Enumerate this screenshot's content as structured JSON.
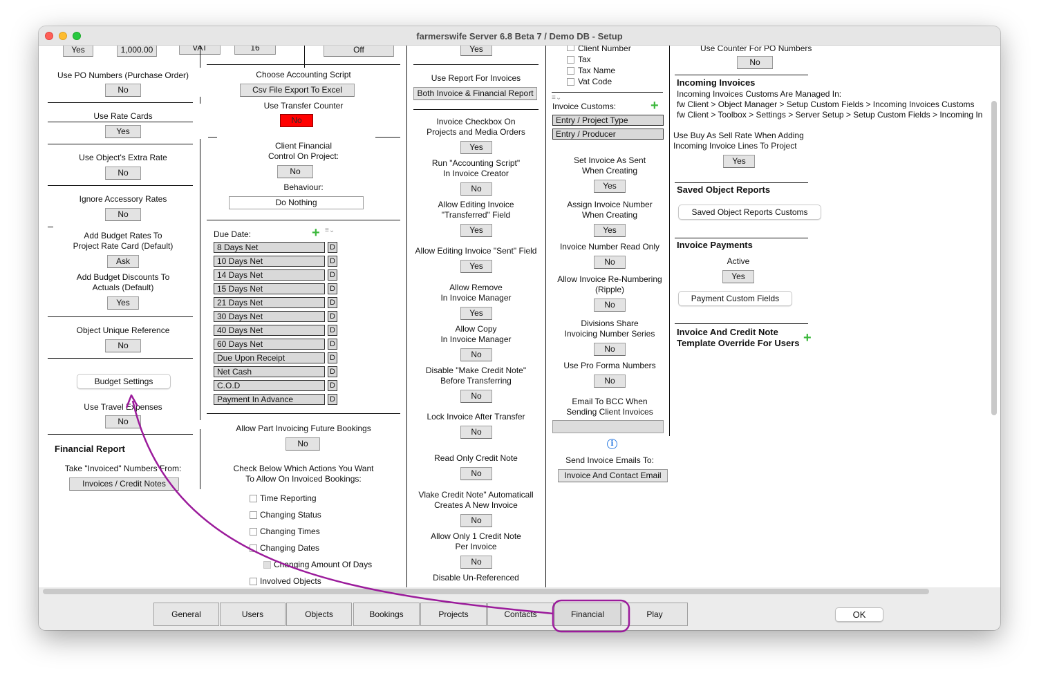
{
  "window": {
    "title": "farmerswife Server 6.8 Beta 7 / Demo DB - Setup"
  },
  "top_partial": {
    "yes1": "Yes",
    "amount": "1,000.00",
    "vat": "VAT",
    "vat_value": "16",
    "off": "Off",
    "yes2": "Yes",
    "client_number": "Client Number",
    "use_counter_po": "Use Counter For PO Numbers",
    "use_counter_po_value": "No"
  },
  "col1": {
    "use_po_numbers": "Use PO Numbers (Purchase Order)",
    "use_po_numbers_value": "No",
    "use_rate_cards": "Use Rate Cards",
    "use_rate_cards_value": "Yes",
    "use_objects_extra_rate": "Use Object's Extra Rate",
    "use_objects_extra_rate_value": "No",
    "ignore_accessory_rates": "Ignore Accessory Rates",
    "ignore_accessory_rates_value": "No",
    "add_budget_rates_1": "Add Budget Rates To",
    "add_budget_rates_2": "Project Rate Card (Default)",
    "add_budget_rates_value": "Ask",
    "add_budget_discounts_1": "Add Budget Discounts To",
    "add_budget_discounts_2": "Actuals (Default)",
    "add_budget_discounts_value": "Yes",
    "object_unique_reference": "Object Unique Reference",
    "object_unique_reference_value": "No",
    "budget_settings": "Budget Settings",
    "use_travel_expenses": "Use Travel Expenses",
    "use_travel_expenses_value": "No",
    "financial_report": "Financial Report",
    "take_invoiced_numbers": "Take \"Invoiced\" Numbers From:",
    "take_invoiced_numbers_value": "Invoices / Credit Notes"
  },
  "col2": {
    "choose_accounting_script": "Choose Accounting Script",
    "choose_accounting_script_value": "Csv File Export To Excel",
    "use_transfer_counter": "Use Transfer Counter",
    "use_transfer_counter_value": "No",
    "client_financial_1": "Client Financial",
    "client_financial_2": "Control On Project:",
    "client_financial_value": "No",
    "behaviour": "Behaviour:",
    "behaviour_value": "Do Nothing",
    "due_date": "Due Date:",
    "due_dates": [
      "8 Days Net",
      "10 Days Net",
      "14 Days Net",
      "15 Days Net",
      "21 Days Net",
      "30 Days Net",
      "40 Days Net",
      "60 Days Net",
      "Due Upon Receipt",
      "Net Cash",
      "C.O.D",
      "Payment In Advance"
    ],
    "d_marker": "D",
    "allow_part_invoicing": "Allow Part Invoicing Future Bookings",
    "allow_part_invoicing_value": "No",
    "check_below_1": "Check Below Which Actions You Want",
    "check_below_2": "To Allow On Invoiced Bookings:",
    "checks": [
      "Time Reporting",
      "Changing Status",
      "Changing Times",
      "Changing Dates",
      "Changing Amount Of Days",
      "Involved Objects"
    ]
  },
  "col3": {
    "use_report_for_invoices": "Use Report For Invoices",
    "use_report_for_invoices_value": "Both Invoice & Financial Report",
    "invoice_checkbox_1": "Invoice Checkbox On",
    "invoice_checkbox_2": "Projects and Media Orders",
    "invoice_checkbox_value": "Yes",
    "run_accounting_1": "Run \"Accounting Script\"",
    "run_accounting_2": "In Invoice Creator",
    "run_accounting_value": "No",
    "allow_editing_transferred_1": "Allow Editing Invoice",
    "allow_editing_transferred_2": "\"Transferred\" Field",
    "allow_editing_transferred_value": "Yes",
    "allow_editing_sent": "Allow Editing Invoice \"Sent\" Field",
    "allow_editing_sent_value": "Yes",
    "allow_remove_1": "Allow Remove",
    "allow_remove_2": "In Invoice Manager",
    "allow_remove_value": "Yes",
    "allow_copy_1": "Allow Copy",
    "allow_copy_2": "In Invoice Manager",
    "allow_copy_value": "No",
    "disable_make_credit_1": "Disable \"Make Credit Note\"",
    "disable_make_credit_2": "Before Transferring",
    "disable_make_credit_value": "No",
    "lock_invoice": "Lock Invoice After Transfer",
    "lock_invoice_value": "No",
    "read_only_credit": "Read Only Credit Note",
    "read_only_credit_value": "No",
    "make_credit_auto_1": "Vlake Credit Note\" Automaticall",
    "make_credit_auto_2": "Creates A New Invoice",
    "make_credit_auto_value": "No",
    "allow_only_one_1": "Allow Only 1 Credit Note",
    "allow_only_one_2": "Per Invoice",
    "allow_only_one_value": "No",
    "disable_unreferenced": "Disable Un-Referenced"
  },
  "col4": {
    "list_fields": [
      "Tax",
      "Tax Name",
      "Vat Code"
    ],
    "invoice_customs": "Invoice Customs:",
    "invoice_customs_items": [
      "Entry / Project Type",
      "Entry / Producer"
    ],
    "set_invoice_sent_1": "Set Invoice As Sent",
    "set_invoice_sent_2": "When Creating",
    "set_invoice_sent_value": "Yes",
    "assign_invoice_number_1": "Assign Invoice Number",
    "assign_invoice_number_2": "When Creating",
    "assign_invoice_number_value": "Yes",
    "invoice_number_read_only": "Invoice Number Read Only",
    "invoice_number_read_only_value": "No",
    "allow_renumbering_1": "Allow Invoice Re-Numbering",
    "allow_renumbering_2": "(Ripple)",
    "allow_renumbering_value": "No",
    "divisions_share_1": "Divisions Share",
    "divisions_share_2": "Invoicing Number Series",
    "divisions_share_value": "No",
    "use_pro_forma": "Use Pro Forma Numbers",
    "use_pro_forma_value": "No",
    "email_bcc_1": "Email To BCC When",
    "email_bcc_2": "Sending Client Invoices",
    "email_bcc_value": "",
    "info_glyph": "i",
    "send_invoice_emails": "Send Invoice Emails To:",
    "send_invoice_emails_value": "Invoice And Contact Email"
  },
  "col5": {
    "incoming_invoices": "Incoming Invoices",
    "incoming_line1": "Incoming Invoices Customs Are Managed In:",
    "incoming_line2": "fw Client > Object Manager > Setup Custom Fields > Incoming Invoices Customs",
    "incoming_line3": "fw Client > Toolbox > Settings > Server Setup > Setup Custom Fields > Incoming In",
    "use_buy_as_sell_1": "Use Buy As Sell Rate When Adding",
    "use_buy_as_sell_2": "Incoming Invoice Lines To Project",
    "use_buy_as_sell_value": "Yes",
    "saved_object_reports": "Saved Object Reports",
    "saved_object_reports_customs": "Saved Object Reports Customs",
    "invoice_payments": "Invoice Payments",
    "active": "Active",
    "active_value": "Yes",
    "payment_custom_fields": "Payment Custom Fields",
    "template_override_1": "Invoice And Credit Note",
    "template_override_2": "Template Override For Users"
  },
  "tabs": [
    "General",
    "Users",
    "Objects",
    "Bookings",
    "Projects",
    "Contacts",
    "Financial",
    "Play"
  ],
  "ok": "OK",
  "colors": {
    "annotation": "#9b1b9b",
    "plus": "#3cb83c",
    "alert": "#ff0000"
  }
}
